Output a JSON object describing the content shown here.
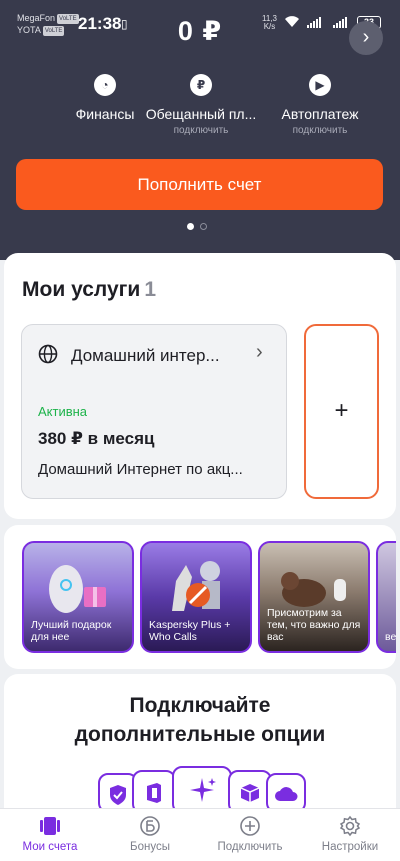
{
  "status_bar": {
    "carrier1": "MegaFon",
    "carrier1_tag": "VoLTE",
    "carrier2": "YOTA",
    "carrier2_tag": "VoLTE",
    "time": "21:38",
    "speed_value": "11,3",
    "speed_unit": "K/s",
    "battery": "33"
  },
  "header": {
    "balance": "0 ₽"
  },
  "quick_actions": [
    {
      "label": "Финансы",
      "sub": "",
      "icon": "clock-money-icon"
    },
    {
      "label": "Обещанный пл...",
      "sub": "подключить",
      "icon": "ruble-circle-icon"
    },
    {
      "label": "Автоплатеж",
      "sub": "подключить",
      "icon": "play-icon"
    }
  ],
  "topup": {
    "label": "Пополнить счет"
  },
  "services": {
    "title": "Мои услуги",
    "count": "1",
    "item": {
      "name": "Домашний интер...",
      "status": "Активна",
      "price": "380 ₽ в месяц",
      "desc": "Домашний Интернет по акц..."
    }
  },
  "stories": [
    {
      "caption": "Лучший подарок для нее"
    },
    {
      "caption": "Kaspersky Plus + Who Calls"
    },
    {
      "caption": "Присмотрим за тем, что важно для вас"
    },
    {
      "caption": "ве..."
    }
  ],
  "options": {
    "title_line1": "Подключайте",
    "title_line2": "дополнительные опции"
  },
  "bottom_nav": [
    {
      "label": "Мои счета",
      "icon": "cards-icon",
      "active": true
    },
    {
      "label": "Бонусы",
      "icon": "bonus-icon",
      "active": false
    },
    {
      "label": "Подключить",
      "icon": "plus-circle-icon",
      "active": false
    },
    {
      "label": "Настройки",
      "icon": "gear-icon",
      "active": false
    }
  ],
  "colors": {
    "header_bg": "#383a4c",
    "accent_orange": "#fa5a1e",
    "accent_purple": "#7a2de0",
    "active_green": "#1db34a"
  }
}
